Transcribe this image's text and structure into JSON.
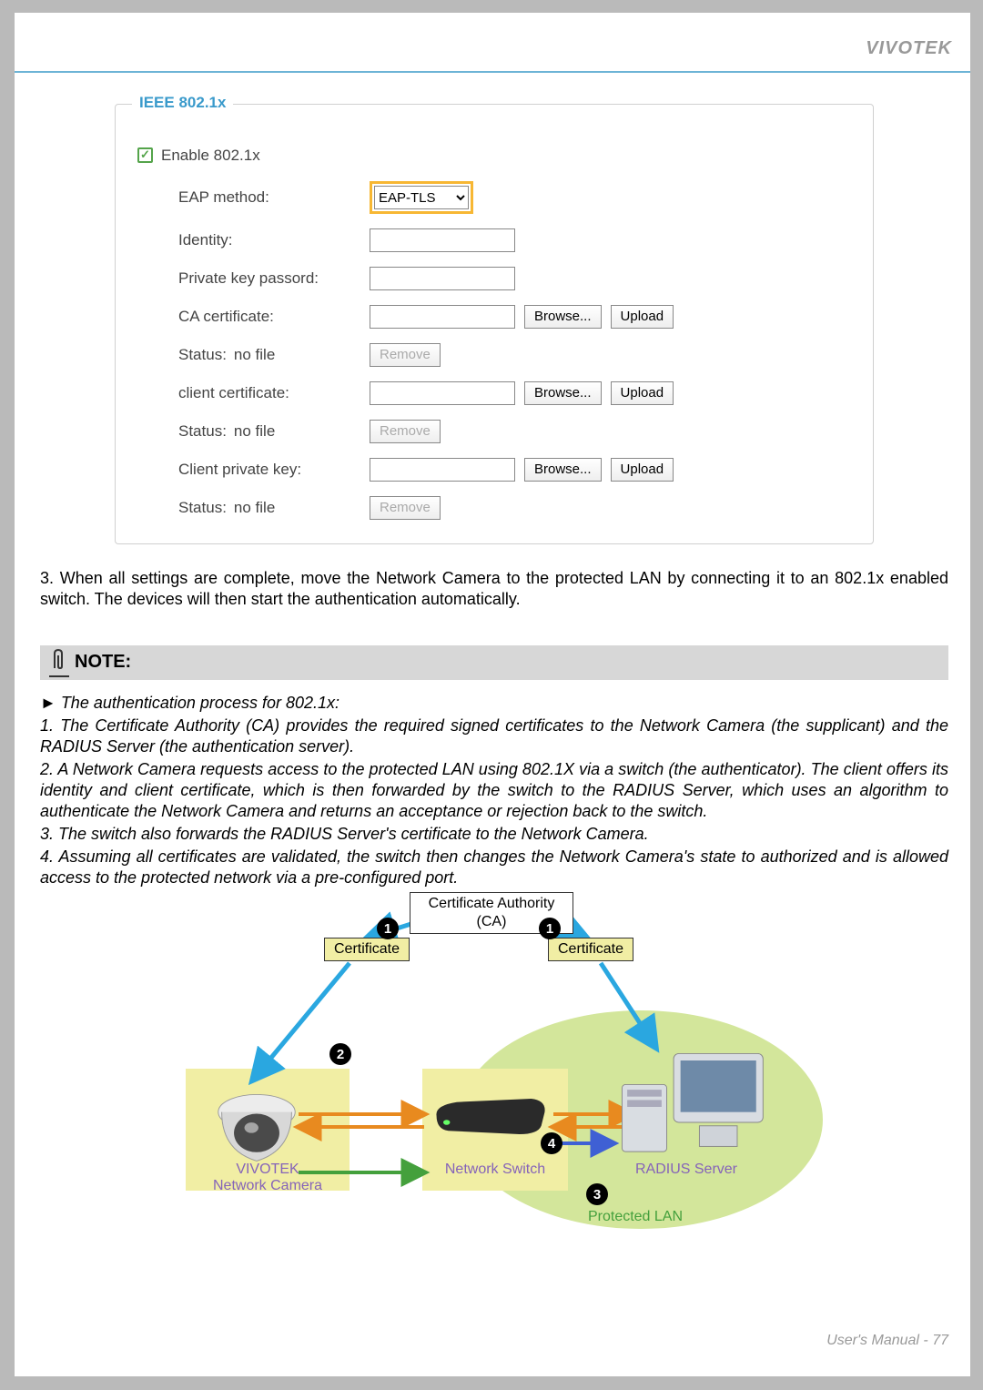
{
  "header": {
    "brand": "VIVOTEK"
  },
  "panel": {
    "legend": "IEEE 802.1x",
    "enable": "Enable 802.1x",
    "eap_label": "EAP method:",
    "eap_value": "EAP-TLS",
    "identity_label": "Identity:",
    "identity_val": "",
    "pk_label": "Private key passord:",
    "pk_val": "",
    "ca_label": "CA certificate:",
    "ca_val": "",
    "browse": "Browse...",
    "upload": "Upload",
    "status": "Status:",
    "nofile": "no file",
    "remove": "Remove",
    "cc_label": "client certificate:",
    "cc_val": "",
    "cpk_label": "Client private key:",
    "cpk_val": ""
  },
  "step3": "3. When all settings are complete, move the Network Camera to the protected LAN by connecting it to an 802.1x enabled switch. The devices will then start the authentication automatically.",
  "note": {
    "title": "NOTE:",
    "l0": "► The authentication process for 802.1x:",
    "l1": "1. The Certificate Authority (CA) provides the required signed certificates to the Network Camera (the supplicant) and the RADIUS Server (the authentication server).",
    "l2": "2. A Network Camera requests access to the protected LAN using 802.1X via a switch (the authenticator). The client offers its identity and client certificate, which is then forwarded by the switch to the RADIUS Server, which uses an algorithm to authenticate the Network Camera and returns an acceptance or rejection back to the switch.",
    "l3": "3. The switch also forwards the RADIUS Server's certificate to the Network Camera.",
    "l4": "4. Assuming all certificates are validated, the switch then changes the Network Camera's state to authorized and is allowed access to the protected network via a pre-configured port."
  },
  "diagram": {
    "ca": "Certificate Authority\n(CA)",
    "cert": "Certificate",
    "cam1": "VIVOTEK",
    "cam2": "Network Camera",
    "sw": "Network Switch",
    "rs": "RADIUS Server",
    "lan": "Protected LAN",
    "s1": "1",
    "s2": "2",
    "s3": "3",
    "s4": "4"
  },
  "footer": "User's Manual - 77",
  "chart_data": {
    "type": "diagram",
    "nodes": [
      {
        "id": "ca",
        "label": "Certificate Authority (CA)"
      },
      {
        "id": "cert_left",
        "label": "Certificate"
      },
      {
        "id": "cert_right",
        "label": "Certificate"
      },
      {
        "id": "camera",
        "label": "VIVOTEK Network Camera"
      },
      {
        "id": "switch",
        "label": "Network Switch"
      },
      {
        "id": "radius",
        "label": "RADIUS Server"
      },
      {
        "id": "lan",
        "label": "Protected LAN"
      }
    ],
    "edges": [
      {
        "from": "ca",
        "to": "cert_left",
        "step": 1
      },
      {
        "from": "ca",
        "to": "cert_right",
        "step": 1
      },
      {
        "from": "cert_left",
        "to": "camera",
        "step": 1
      },
      {
        "from": "cert_right",
        "to": "radius",
        "step": 1
      },
      {
        "from": "camera",
        "to": "switch",
        "step": 2,
        "bidir": true
      },
      {
        "from": "switch",
        "to": "radius",
        "step": 2,
        "bidir": true
      },
      {
        "from": "radius",
        "to": "switch",
        "step": 3
      },
      {
        "from": "switch",
        "to": "camera",
        "step": 3
      },
      {
        "from": "switch",
        "to": "radius",
        "step": 4
      }
    ]
  }
}
